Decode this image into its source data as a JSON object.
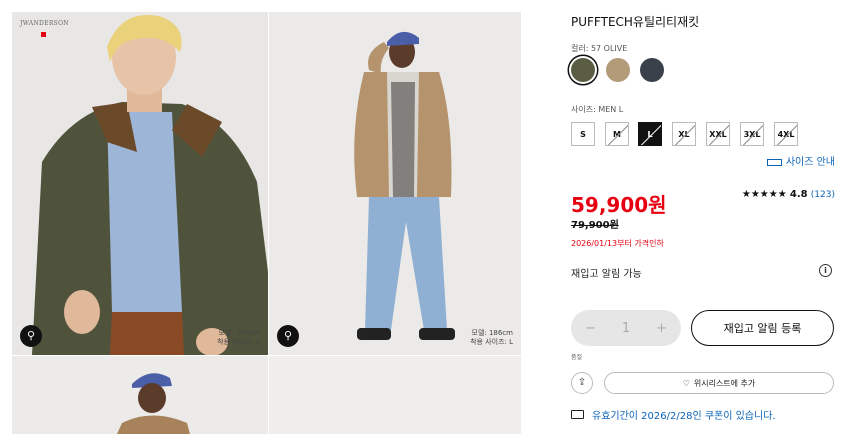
{
  "gallery": {
    "brand_text": "JWANDERSON",
    "images": [
      {
        "model_height": "모델: 186cm",
        "worn_size": "착용 사이즈: L"
      },
      {
        "model_height": "모델: 186cm",
        "worn_size": "착용 사이즈: L"
      }
    ],
    "hanger_icon": "hanger-icon"
  },
  "product": {
    "title": "PUFFTECH유틸리티재킷",
    "color_label": "컬러: 57 OLIVE",
    "colors": [
      {
        "hex": "#5a5c44",
        "selected": true
      },
      {
        "hex": "#b39a78",
        "selected": false
      },
      {
        "hex": "#3b414b",
        "selected": false
      }
    ],
    "size_label": "사이즈: MEN L",
    "sizes": [
      {
        "label": "S",
        "crossed": false,
        "selected": false
      },
      {
        "label": "M",
        "crossed": true,
        "selected": false
      },
      {
        "label": "L",
        "crossed": true,
        "selected": true
      },
      {
        "label": "XL",
        "crossed": true,
        "selected": false
      },
      {
        "label": "XXL",
        "crossed": true,
        "selected": false
      },
      {
        "label": "3XL",
        "crossed": true,
        "selected": false
      },
      {
        "label": "4XL",
        "crossed": true,
        "selected": false
      }
    ],
    "size_guide": "사이즈 안내",
    "price": "59,900원",
    "original_price": "79,900원",
    "price_note": "2026/01/13부터 가격인하",
    "rating_stars": "★★★★★",
    "rating_score": "4.8",
    "rating_count": "(123)",
    "restock_text": "재입고 알림 가능",
    "quantity": "1",
    "minus": "−",
    "plus": "+",
    "notify_button": "재입고 알림 등록",
    "small_note": "품절",
    "share_icon": "⇪",
    "wishlist_label": "위시리스트에 추가",
    "coupon_text": "유효기간이 2026/2/28인 쿠폰이 있습니다.",
    "accent_red": "#e60012",
    "link_blue": "#0b63b6"
  }
}
